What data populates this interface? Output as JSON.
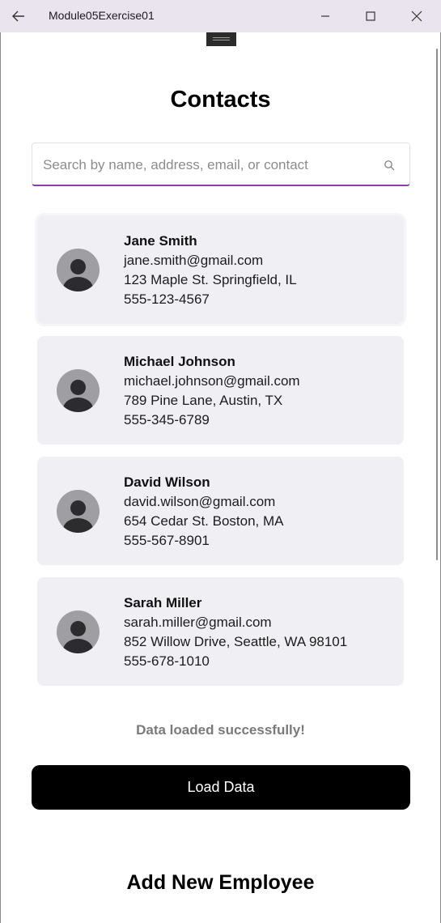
{
  "window": {
    "title": "Module05Exercise01",
    "back_icon": "back-arrow-icon",
    "minimize_icon": "minimize-icon",
    "maximize_icon": "maximize-icon",
    "close_icon": "close-icon"
  },
  "page": {
    "title": "Contacts"
  },
  "search": {
    "placeholder": "Search by name, address, email, or contact",
    "value": "",
    "icon": "search-icon",
    "accent": "#8a3ea6"
  },
  "contacts": [
    {
      "name": "Jane Smith",
      "email": "jane.smith@gmail.com",
      "address": "123 Maple St. Springfield, IL",
      "phone": "555-123-4567"
    },
    {
      "name": "Michael Johnson",
      "email": "michael.johnson@gmail.com",
      "address": "789 Pine Lane, Austin, TX",
      "phone": "555-345-6789"
    },
    {
      "name": "David Wilson",
      "email": "david.wilson@gmail.com",
      "address": "654 Cedar St. Boston, MA",
      "phone": "555-567-8901"
    },
    {
      "name": "Sarah Miller",
      "email": "sarah.miller@gmail.com",
      "address": "852 Willow Drive, Seattle, WA 98101",
      "phone": "555-678-1010"
    }
  ],
  "status": {
    "message": "Data loaded successfully!"
  },
  "actions": {
    "load_label": "Load Data"
  },
  "section": {
    "title": "Add New Employee"
  },
  "colors": {
    "card_bg": "#f0eff4",
    "button_bg": "#000000",
    "status_text": "#7a7a7a"
  }
}
